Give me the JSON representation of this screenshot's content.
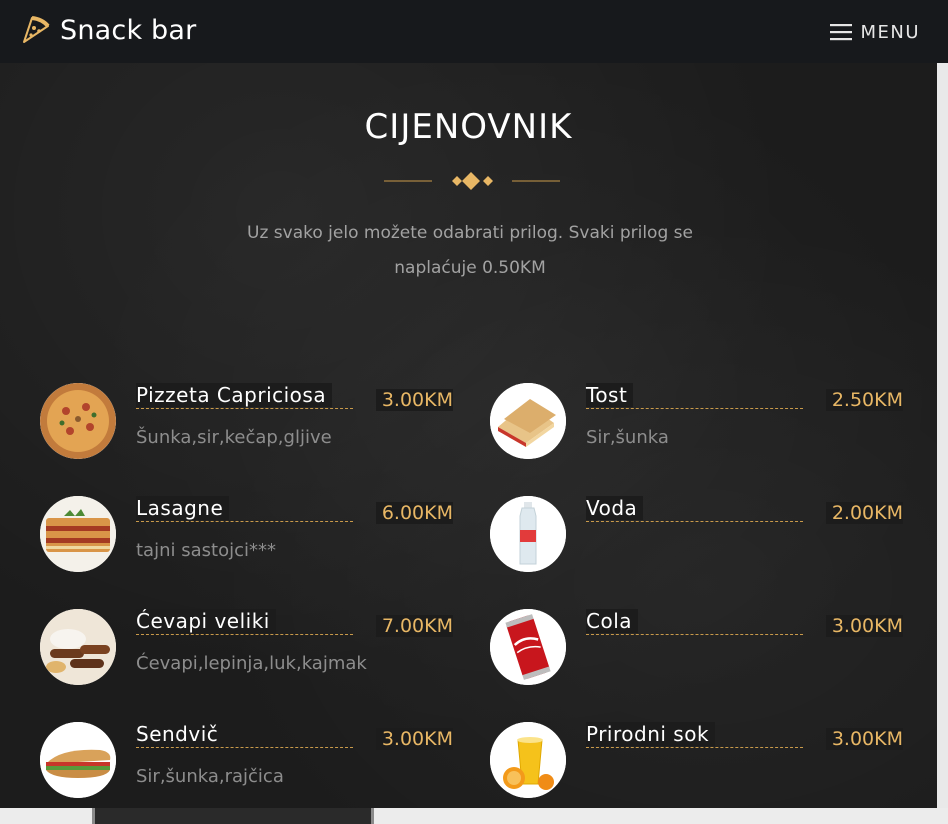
{
  "brand": {
    "name": "Snack bar",
    "logo_icon": "pizza-slice-icon"
  },
  "nav": {
    "menu_label": "MENU",
    "menu_icon": "hamburger-icon"
  },
  "section": {
    "title": "CIJENOVNIK",
    "subtitle": "Uz svako jelo možete odabrati prilog. Svaki prilog se naplaćuje 0.50KM"
  },
  "colors": {
    "accent": "#e8b765",
    "background": "#1c1c1c",
    "navbar": "#17191c"
  },
  "left_items": [
    {
      "name": "Pizzeta Capriciosa",
      "price": "3.00KM",
      "desc": "Šunka,sir,kečap,gljive",
      "image": "pizza"
    },
    {
      "name": "Lasagne",
      "price": "6.00KM",
      "desc": "tajni sastojci***",
      "image": "lasagne"
    },
    {
      "name": "Ćevapi veliki",
      "price": "7.00KM",
      "desc": "Ćevapi,lepinja,luk,kajmak",
      "image": "cevapi"
    },
    {
      "name": "Sendvič",
      "price": "3.00KM",
      "desc": "Sir,šunka,rajčica",
      "image": "sandwich"
    }
  ],
  "right_items": [
    {
      "name": "Tost",
      "price": "2.50KM",
      "desc": "Sir,šunka",
      "image": "toast"
    },
    {
      "name": "Voda",
      "price": "2.00KM",
      "desc": "",
      "image": "water"
    },
    {
      "name": "Cola",
      "price": "3.00KM",
      "desc": "",
      "image": "cola"
    },
    {
      "name": "Prirodni sok",
      "price": "3.00KM",
      "desc": "",
      "image": "juice"
    }
  ]
}
